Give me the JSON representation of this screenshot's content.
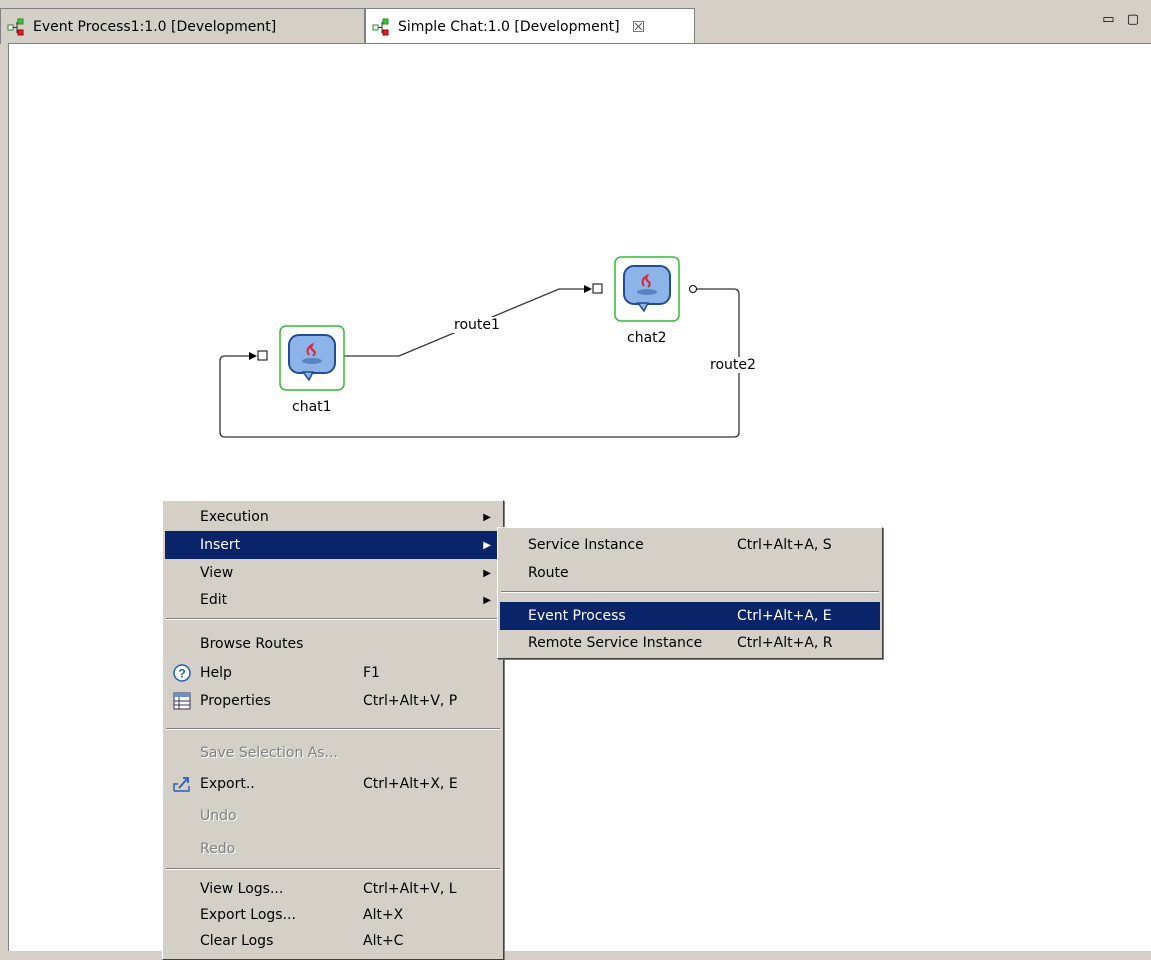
{
  "tabs": [
    {
      "label": "Event Process1:1.0 [Development]",
      "icon": "process-icon",
      "active": false
    },
    {
      "label": "Simple Chat:1.0 [Development]",
      "icon": "process-icon",
      "active": true,
      "close": "☒"
    }
  ],
  "window_controls": "▭ ▢",
  "diagram": {
    "nodes": [
      {
        "label": "chat1",
        "icon": "java-service-icon"
      },
      {
        "label": "chat2",
        "icon": "java-service-icon"
      }
    ],
    "routes": [
      {
        "label": "route1"
      },
      {
        "label": "route2"
      }
    ]
  },
  "context_menu": {
    "items": [
      {
        "label": "Execution",
        "submenu": true
      },
      {
        "label": "Insert",
        "submenu": true,
        "selected": true
      },
      {
        "label": "View",
        "submenu": true
      },
      {
        "label": "Edit",
        "submenu": true
      },
      {
        "label": "Browse Routes"
      },
      {
        "label": "Help",
        "accel": "F1",
        "icon": "help-icon"
      },
      {
        "label": "Properties",
        "accel": "Ctrl+Alt+V, P",
        "icon": "properties-icon"
      },
      {
        "label": "Save Selection As...",
        "disabled": true
      },
      {
        "label": "Export..",
        "accel": "Ctrl+Alt+X, E",
        "icon": "export-icon"
      },
      {
        "label": "Undo",
        "disabled": true
      },
      {
        "label": "Redo",
        "disabled": true
      },
      {
        "label": "View Logs...",
        "accel": "Ctrl+Alt+V, L"
      },
      {
        "label": "Export Logs...",
        "accel": "Alt+X"
      },
      {
        "label": "Clear Logs",
        "accel": "Alt+C"
      }
    ]
  },
  "insert_submenu": {
    "items": [
      {
        "label": "Service Instance",
        "accel": "Ctrl+Alt+A, S"
      },
      {
        "label": "Route",
        "accel": ""
      },
      {
        "label": "Event Process",
        "accel": "Ctrl+Alt+A, E",
        "selected": true
      },
      {
        "label": "Remote Service Instance",
        "accel": "Ctrl+Alt+A, R"
      }
    ]
  },
  "colors": {
    "selection": "#0a246a",
    "node_border": "#33bb33",
    "menu_bg": "#d4d0c8"
  }
}
